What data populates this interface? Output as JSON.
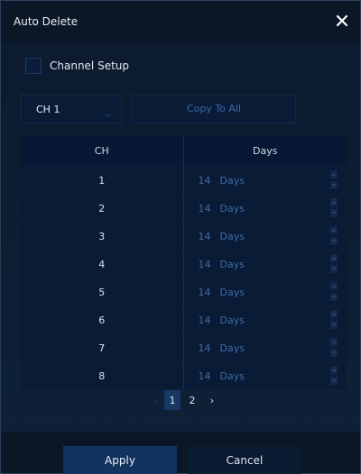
{
  "dialog": {
    "title": "Auto Delete"
  },
  "channel_setup": {
    "label": "Channel Setup",
    "checked": false
  },
  "channel_select": {
    "value": "CH 1"
  },
  "copy_button": {
    "label": "Copy To All"
  },
  "table": {
    "headers": {
      "ch": "CH",
      "days": "Days"
    },
    "rows": [
      {
        "ch": "1",
        "days": "14",
        "unit": "Days"
      },
      {
        "ch": "2",
        "days": "14",
        "unit": "Days"
      },
      {
        "ch": "3",
        "days": "14",
        "unit": "Days"
      },
      {
        "ch": "4",
        "days": "14",
        "unit": "Days"
      },
      {
        "ch": "5",
        "days": "14",
        "unit": "Days"
      },
      {
        "ch": "6",
        "days": "14",
        "unit": "Days"
      },
      {
        "ch": "7",
        "days": "14",
        "unit": "Days"
      },
      {
        "ch": "8",
        "days": "14",
        "unit": "Days"
      }
    ]
  },
  "pagination": {
    "prev": "‹",
    "pages": [
      "1",
      "2"
    ],
    "current": "1",
    "next": "›"
  },
  "buttons": {
    "apply": "Apply",
    "cancel": "Cancel"
  },
  "colors": {
    "accent": "#12335e",
    "background": "#0e1e33",
    "muted_value": "#3d6aa6"
  }
}
